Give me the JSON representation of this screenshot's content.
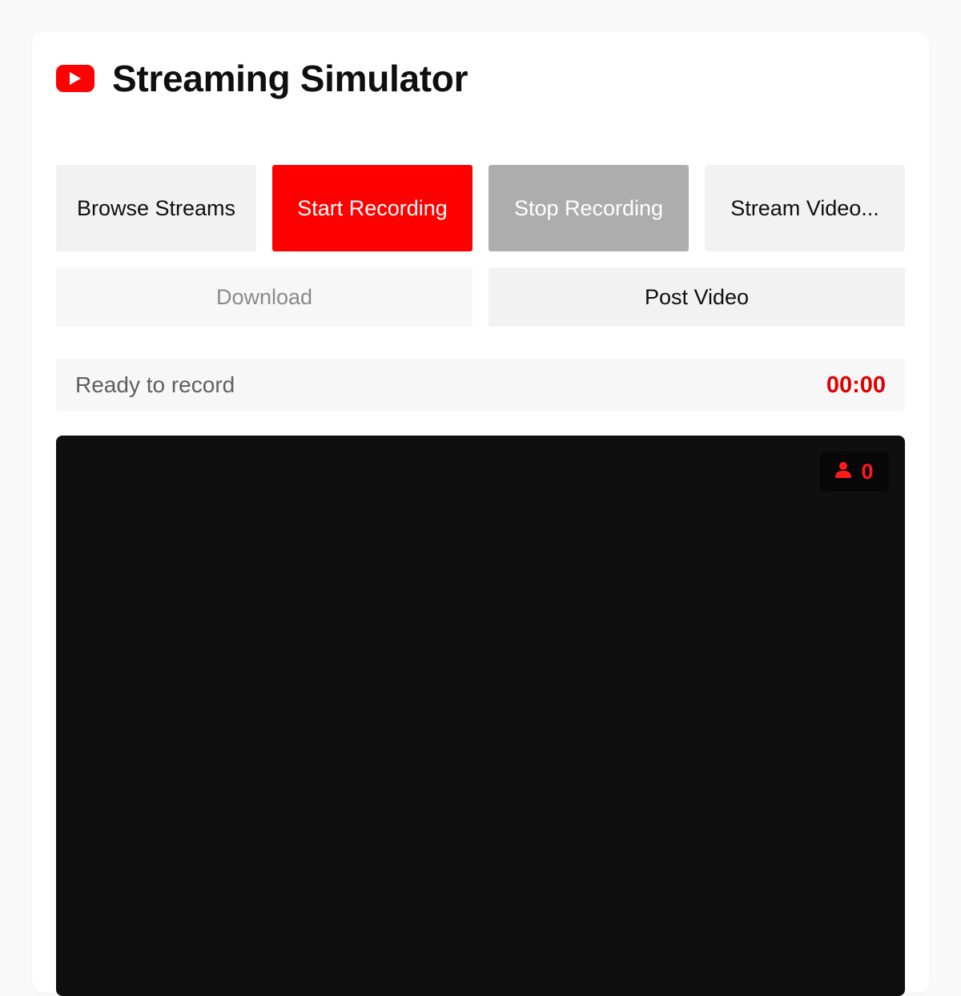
{
  "app": {
    "title": "Streaming Simulator",
    "logo_icon": "youtube-play-icon",
    "accent_color": "#ff0000"
  },
  "toolbar": {
    "browse_label": "Browse Streams",
    "start_label": "Start Recording",
    "stop_label": "Stop Recording",
    "stream_label": "Stream Video...",
    "download_label": "Download",
    "post_label": "Post Video"
  },
  "status": {
    "message": "Ready to record",
    "timer": "00:00"
  },
  "video": {
    "viewer_icon": "person-icon",
    "viewer_count": "0"
  }
}
